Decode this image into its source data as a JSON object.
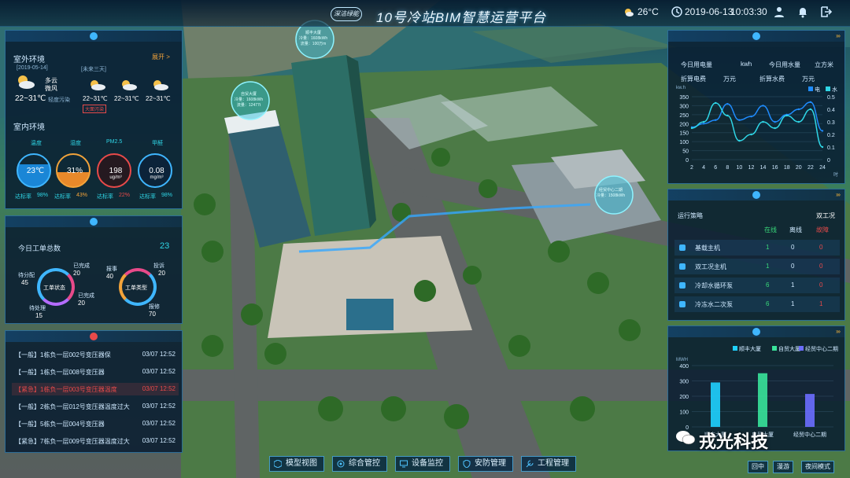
{
  "header": {
    "logo_text": "深洁绿能",
    "title": "10号冷站BIM智慧运营平台",
    "temperature": "26°C",
    "date": "2019-06-13",
    "time": "10:03:30"
  },
  "environment": {
    "outdoor_title": "室外环境",
    "expand_label": "展开 >",
    "today_date": "[2019-05-14]",
    "today_weather": "多云",
    "today_wind": "微风",
    "today_temp": "22~31℃",
    "today_aqi": "轻度污染",
    "forecast_label": "[未来三天]",
    "forecast": [
      {
        "temp": "22~31℃"
      },
      {
        "temp": "22~31℃"
      },
      {
        "temp": "22~31℃"
      }
    ],
    "forecast_tag": "大面污染",
    "indoor_title": "室内环境",
    "indicators": [
      {
        "name": "温度",
        "value": "23℃",
        "unit": "",
        "rate_label": "达标率",
        "rate": "98%",
        "level": 0.98
      },
      {
        "name": "湿度",
        "value": "31%",
        "unit": "",
        "rate_label": "达标率",
        "rate": "43%",
        "level": 0.43
      },
      {
        "name": "PM2.5",
        "value": "198",
        "unit": "ug/m³",
        "rate_label": "达标率",
        "rate": "22%",
        "level": 0.22
      },
      {
        "name": "甲醛",
        "value": "0.08",
        "unit": "mg/m³",
        "rate_label": "达标率",
        "rate": "98%",
        "level": 0.98
      }
    ]
  },
  "workorders": {
    "title": "今日工单总数",
    "total": "23",
    "status_label": "工单状态",
    "type_label": "工单类型",
    "status": [
      {
        "name": "待分配",
        "value": "45"
      },
      {
        "name": "已完成",
        "value": "20"
      },
      {
        "name": "已完成",
        "value": "20"
      },
      {
        "name": "待处理",
        "value": "15"
      }
    ],
    "types": [
      {
        "name": "报事",
        "value": "40"
      },
      {
        "name": "投诉",
        "value": "20"
      },
      {
        "name": "报修",
        "value": "70"
      }
    ]
  },
  "alarms": {
    "rows": [
      {
        "text": "【一般】1栋负一层002号变压器保",
        "date": "03/07 12:52"
      },
      {
        "text": "【一般】1栋负一层008号变压器",
        "date": "03/07 12:52"
      },
      {
        "text": "【紧急】1栋负一层003号变压器温度",
        "date": "03/07 12:52"
      },
      {
        "text": "【一般】2栋负一层012号变压器温度过大",
        "date": "03/07 12:52"
      },
      {
        "text": "【一般】5栋负一层004号变压器",
        "date": "03/07 12:52"
      },
      {
        "text": "【紧急】7栋负一层009号变压器温度过大",
        "date": "03/07 12:52"
      }
    ]
  },
  "energy": {
    "elec_label": "今日用电量",
    "elec_unit": "kwh",
    "water_label": "今日用水量",
    "water_unit": "立方米",
    "elec_fee_label": "折算电费",
    "elec_fee_unit": "万元",
    "water_fee_label": "折算水费",
    "water_fee_unit": "万元",
    "legend_elec": "电",
    "legend_water": "水",
    "left_unit": "kw.h",
    "right_unit": "m³",
    "x_unit": "时"
  },
  "chart_data": [
    {
      "type": "line",
      "x": [
        2,
        4,
        6,
        8,
        10,
        12,
        14,
        16,
        18,
        20,
        22,
        24
      ],
      "series": [
        {
          "name": "电",
          "values": [
            180,
            200,
            220,
            310,
            220,
            240,
            300,
            210,
            250,
            280,
            320,
            160
          ]
        },
        {
          "name": "水",
          "values": [
            0.25,
            0.3,
            0.45,
            0.35,
            0.15,
            0.2,
            0.3,
            0.25,
            0.35,
            0.3,
            0.4,
            0.1
          ]
        }
      ],
      "ylim": [
        0,
        350
      ],
      "y2lim": [
        0,
        0.5
      ],
      "yticks": [
        0,
        50,
        100,
        150,
        200,
        250,
        300,
        350
      ],
      "y2ticks": [
        0,
        0.1,
        0.2,
        0.3,
        0.4,
        0.5
      ]
    },
    {
      "type": "bar",
      "categories": [
        "顺丰大厦",
        "自贸大厦",
        "经贸中心二期"
      ],
      "values": [
        290,
        350,
        215
      ],
      "ylim": [
        0,
        400
      ],
      "yticks": [
        0,
        100,
        200,
        300,
        400
      ],
      "ylabel": "MWH",
      "colors": [
        "#1fd1ff",
        "#39e39a",
        "#6b6dff"
      ]
    }
  ],
  "equipment": {
    "strategy_label": "运行策略",
    "mode_value": "双工况",
    "col_online": "在线",
    "col_offline": "离线",
    "col_fault": "故障",
    "rows": [
      {
        "name": "基载主机",
        "online": "1",
        "offline": "0",
        "fault": "0"
      },
      {
        "name": "双工况主机",
        "online": "1",
        "offline": "0",
        "fault": "0"
      },
      {
        "name": "冷却水循环泵",
        "online": "6",
        "offline": "1",
        "fault": "0"
      },
      {
        "name": "冷冻水二次泵",
        "online": "6",
        "offline": "1",
        "fault": "1"
      }
    ]
  },
  "consumption": {
    "unit": "MWH",
    "legend": [
      "顺丰大厦",
      "自贸大厦",
      "经贸中心二期"
    ]
  },
  "building_tags": [
    {
      "name": "顺丰大厦",
      "l1": "冷量：1608kWh",
      "l2": "流量：100万m"
    },
    {
      "name": "自贸大厦",
      "l1": "冷量：1608kWh",
      "l2": "流量：12477t"
    },
    {
      "name": "经贸中心二期",
      "l1": "冷量：1508kWh",
      "l2": ""
    }
  ],
  "nav": [
    "模型视图",
    "综合管控",
    "设备监控",
    "安防管理",
    "工程管理"
  ],
  "corner_buttons": [
    "回中",
    "漫游",
    "夜间模式"
  ],
  "watermark": "戎光科技"
}
